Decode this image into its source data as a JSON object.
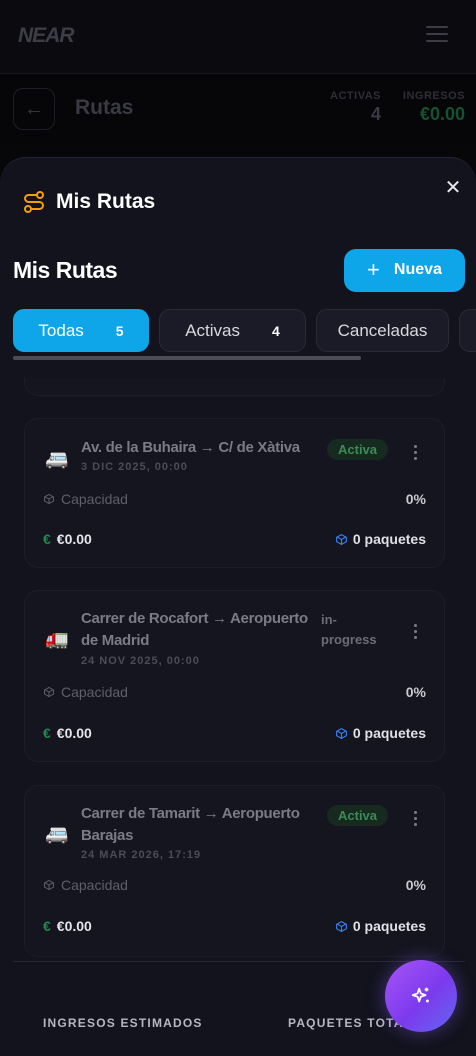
{
  "app": {
    "logo": "NEAR",
    "page_title": "Rutas",
    "stats": [
      {
        "label": "ACTIVAS",
        "value": "4",
        "color": "#3a3a44"
      },
      {
        "label": "INGRESOS",
        "value": "€0.00",
        "color": "#14532d"
      }
    ]
  },
  "panel": {
    "header_title": "Mis Rutas",
    "section_title": "Mis Rutas",
    "new_button": "Nueva",
    "tabs": [
      {
        "label": "Todas",
        "count": "5",
        "active": true
      },
      {
        "label": "Activas",
        "count": "4",
        "active": false
      },
      {
        "label": "Canceladas",
        "count": "",
        "active": false
      }
    ],
    "routes": [
      {
        "name": "Av. de la Buhaira → C/ de Xàtiva",
        "date": "3 DIC 2025, 00:00",
        "status": "Activa",
        "capacity_label": "Capacidad",
        "capacity": "0%",
        "currency": "€",
        "amount": "€0.00",
        "packages": "0 paquetes",
        "icon": "truck-icon"
      },
      {
        "name": "Carrer de Rocafort → Aeropuerto de Madrid",
        "date": "24 NOV 2025, 00:00",
        "status": "in-progress",
        "capacity_label": "Capacidad",
        "capacity": "0%",
        "currency": "€",
        "amount": "€0.00",
        "packages": "0 paquetes",
        "icon": "truck-icon"
      },
      {
        "name": "Carrer de Tamarit → Aeropuerto Barajas",
        "date": "24 MAR 2026, 17:19",
        "status": "Activa",
        "capacity_label": "Capacidad",
        "capacity": "0%",
        "currency": "€",
        "amount": "€0.00",
        "packages": "0 paquetes",
        "icon": "truck-icon"
      }
    ],
    "footer": {
      "income_label": "INGRESOS ESTIMADOS",
      "packages_label": "PAQUETES TOTALES"
    }
  },
  "colors": {
    "accent": "#0ea5e9",
    "active_badge": "#3c8a57",
    "fab": "#8b5cf6",
    "route_icon": "#f59e0b"
  }
}
